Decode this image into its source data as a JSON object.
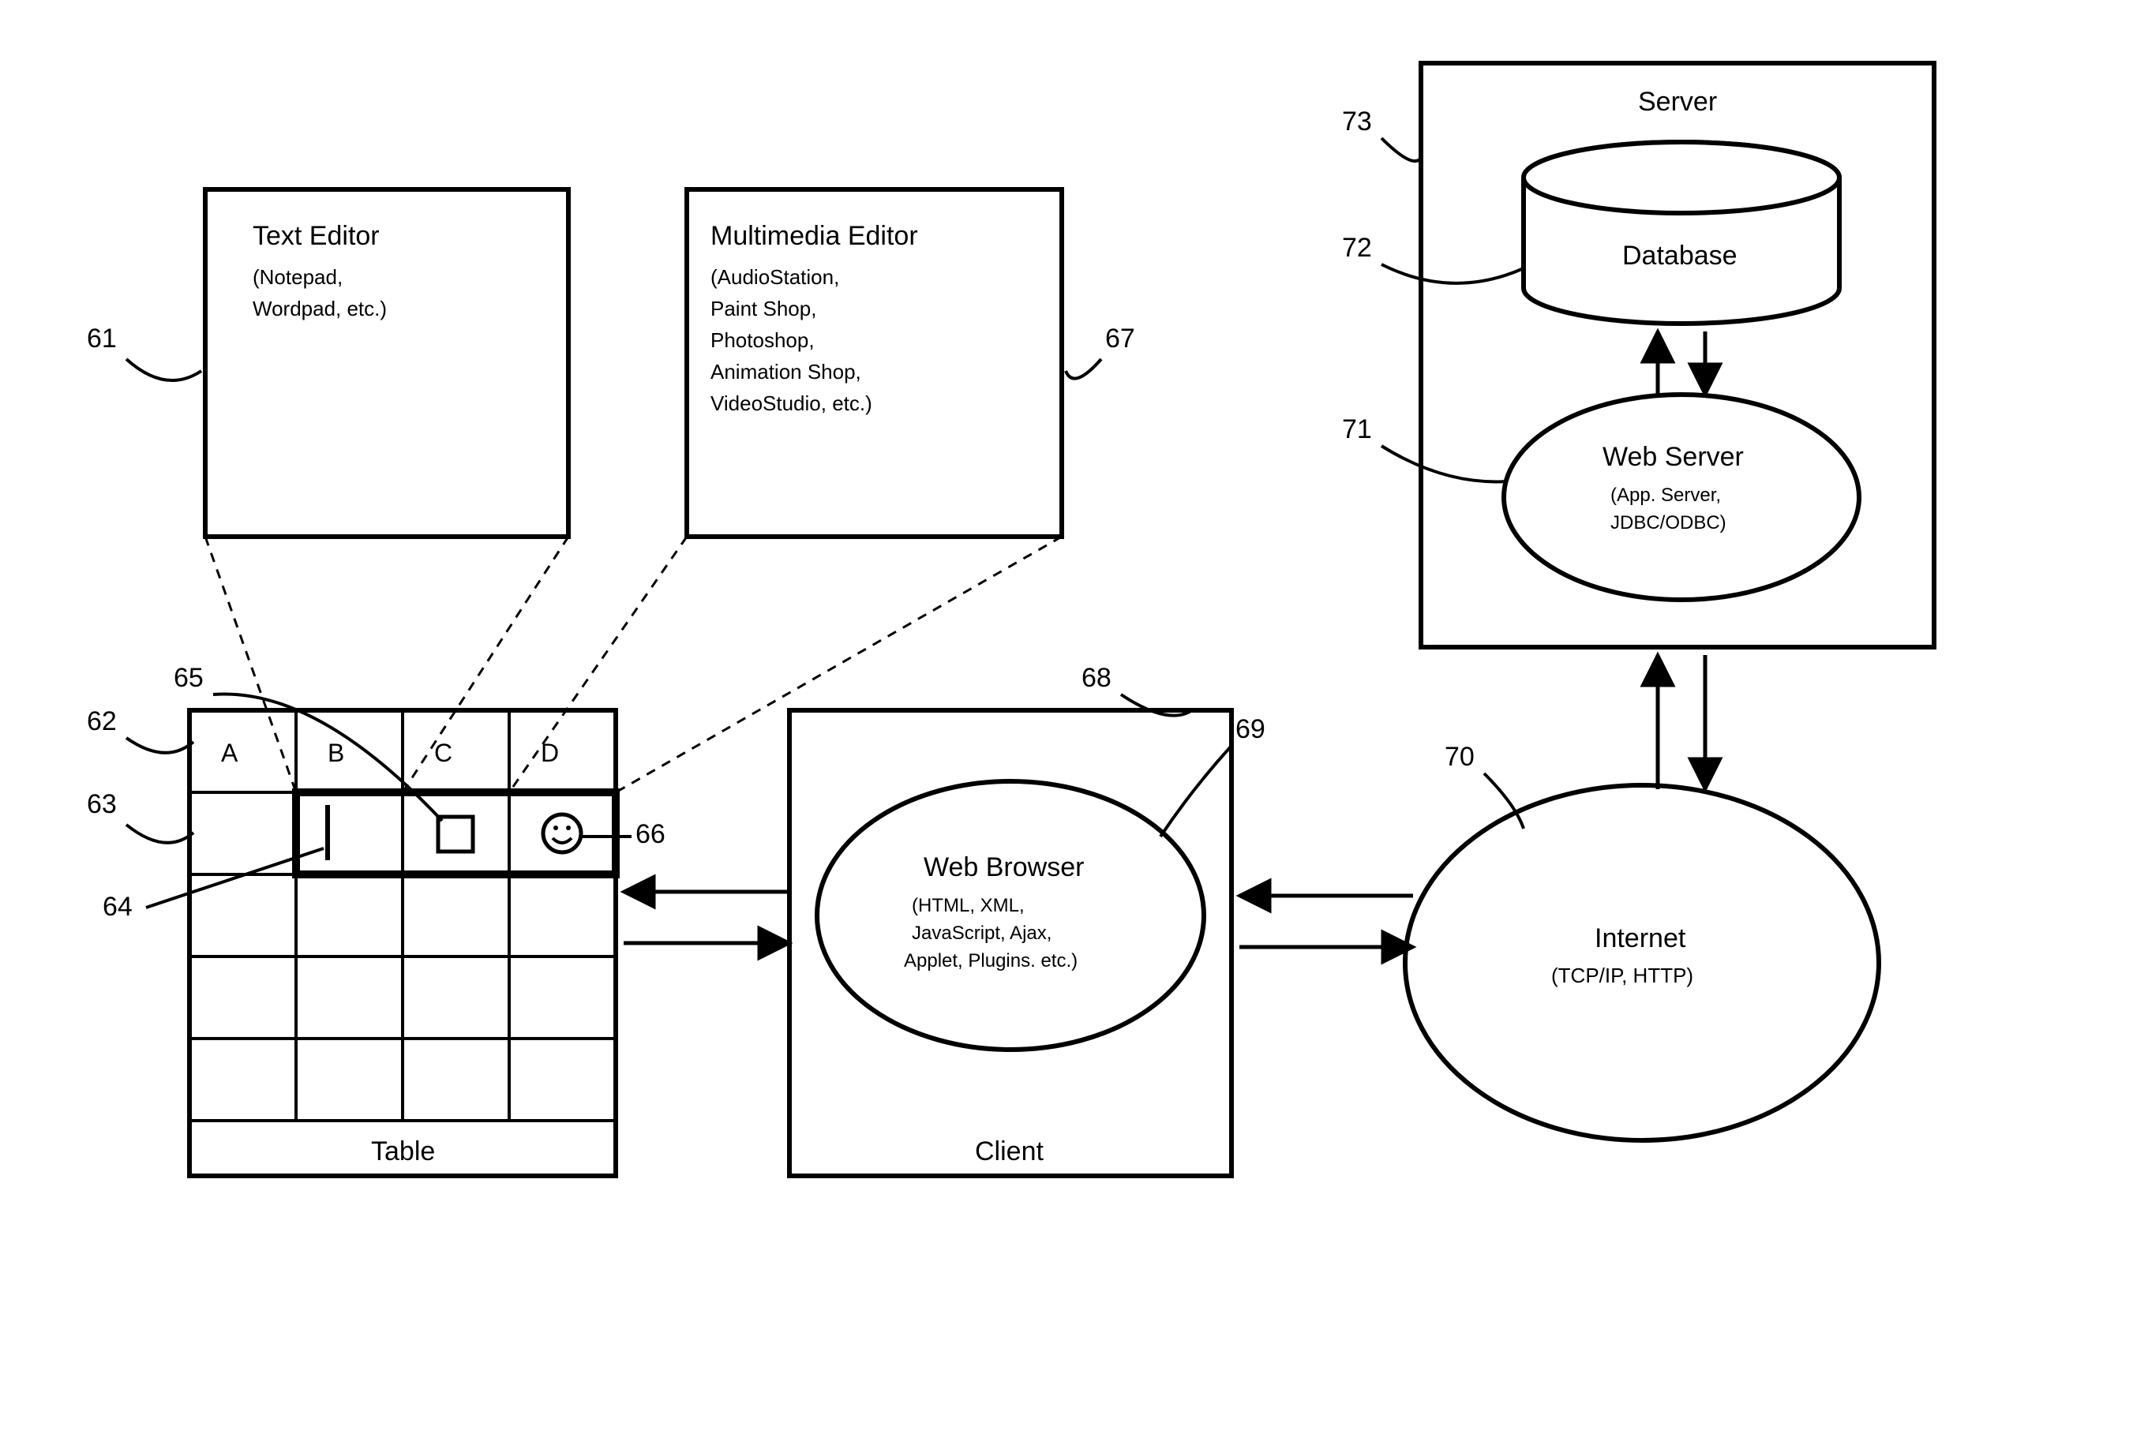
{
  "refs": {
    "r61": "61",
    "r62": "62",
    "r63": "63",
    "r64": "64",
    "r65": "65",
    "r66": "66",
    "r67": "67",
    "r68": "68",
    "r69": "69",
    "r70": "70",
    "r71": "71",
    "r72": "72",
    "r73": "73"
  },
  "textEditor": {
    "title": "Text Editor",
    "line1": "(Notepad,",
    "line2": "Wordpad, etc.)"
  },
  "multimediaEditor": {
    "title": "Multimedia Editor",
    "line1": "(AudioStation,",
    "line2": "Paint Shop,",
    "line3": "Photoshop,",
    "line4": "Animation Shop,",
    "line5": "VideoStudio, etc.)"
  },
  "table": {
    "label": "Table",
    "headers": {
      "a": "A",
      "b": "B",
      "c": "C",
      "d": "D"
    }
  },
  "client": {
    "label": "Client",
    "browser": {
      "title": "Web Browser",
      "line1": "(HTML, XML,",
      "line2": "JavaScript, Ajax,",
      "line3": "Applet, Plugins. etc.)"
    }
  },
  "internet": {
    "title": "Internet",
    "line1": "(TCP/IP, HTTP)"
  },
  "server": {
    "label": "Server",
    "webserver": {
      "title": "Web Server",
      "line1": "(App. Server,",
      "line2": "JDBC/ODBC)"
    },
    "database": {
      "title": "Database"
    }
  }
}
